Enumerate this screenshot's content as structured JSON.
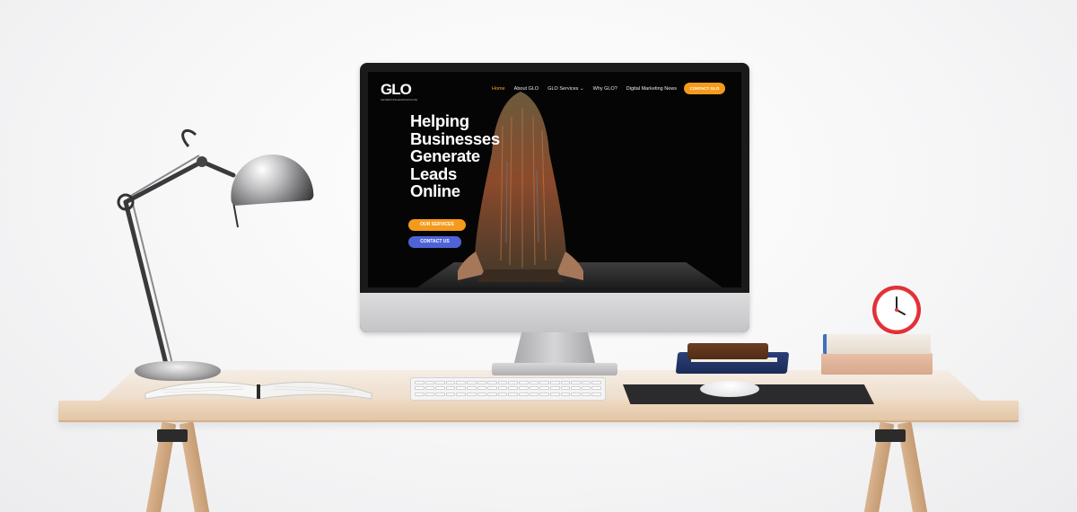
{
  "website": {
    "logo": "GLO",
    "logo_tagline": "GENERATELEADSONLINE",
    "nav": {
      "home": "Home",
      "about": "About GLO",
      "services": "GLO Services",
      "why": "Why GLO?",
      "news": "Digital Marketing News",
      "contact_cta": "CONTACT GLO"
    },
    "hero": {
      "line1": "Helping",
      "line2": "Businesses",
      "line3": "Generate",
      "line4": "Leads",
      "line5": "Online"
    },
    "buttons": {
      "services": "OUR SERVICES",
      "contact": "CONTACT US"
    }
  },
  "colors": {
    "accent_orange": "#f59a1b",
    "accent_blue": "#4f63d8",
    "active_nav": "#f5a623",
    "screen_bg": "#050505"
  },
  "icons": {
    "services_dropdown": "chevron-down-icon",
    "clock": "alarm-clock-icon",
    "lamp": "desk-lamp-icon"
  }
}
